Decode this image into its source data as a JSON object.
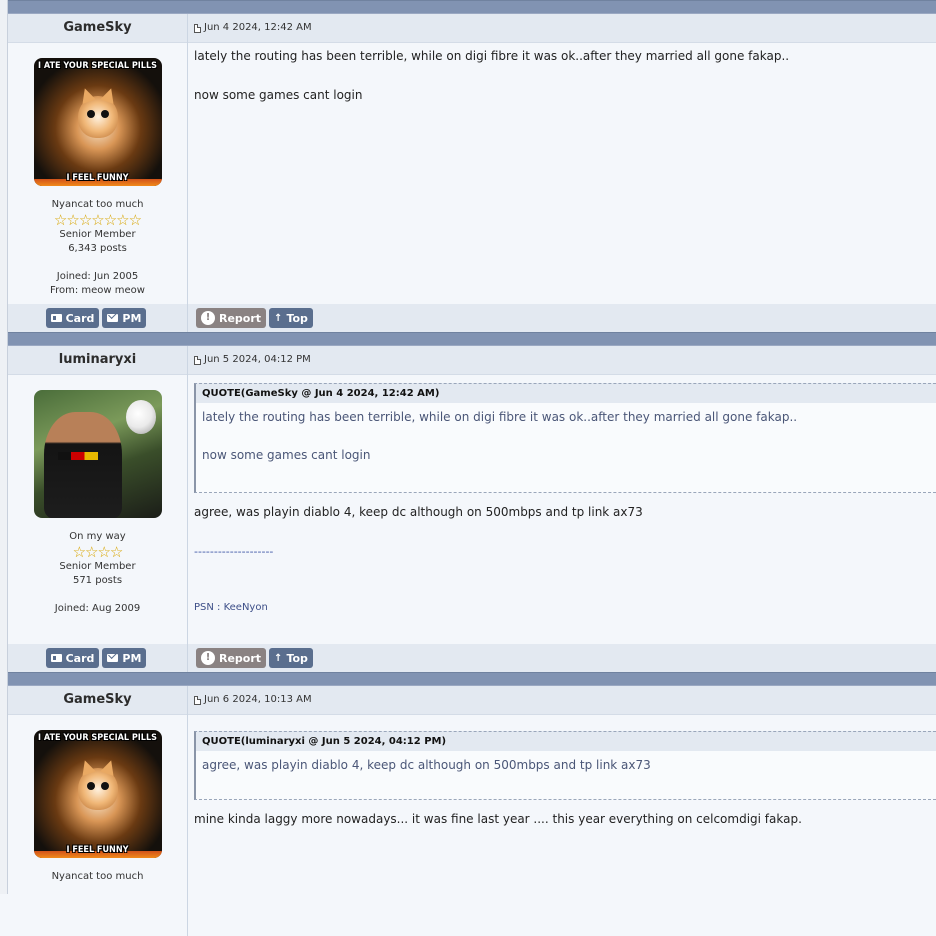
{
  "posts": [
    {
      "author": "GameSky",
      "date": "Jun 4 2024, 12:42 AM",
      "avatar": {
        "caption_top": "I ATE YOUR SPECIAL PILLS",
        "caption_bottom": "I FEEL FUNNY"
      },
      "title": "Nyancat too much",
      "stars": "☆☆☆☆☆☆☆",
      "rank": "Senior Member",
      "posts": "6,343 posts",
      "joined": "Joined: Jun 2005",
      "from": "From: meow meow",
      "body": [
        "lately the routing has been terrible, while on digi fibre it was ok..after they married all gone fakap..",
        "now some games cant login"
      ]
    },
    {
      "author": "luminaryxi",
      "date": "Jun 5 2024, 04:12 PM",
      "title": "On my way",
      "stars": "☆☆☆☆",
      "rank": "Senior Member",
      "posts": "571 posts",
      "joined": "Joined: Aug 2009",
      "quote": {
        "header": "QUOTE(GameSky @ Jun 4 2024, 12:42 AM)",
        "lines": [
          "lately the routing has been terrible, while on digi fibre it was ok..after they married all gone fakap..",
          "now some games cant login"
        ]
      },
      "body": [
        "agree, was playin diablo 4, keep dc although on 500mbps and tp link ax73"
      ],
      "sig_separator": "--------------------",
      "signature": "PSN : KeeNyon"
    },
    {
      "author": "GameSky",
      "date": "Jun 6 2024, 10:13 AM",
      "avatar": {
        "caption_top": "I ATE YOUR SPECIAL PILLS",
        "caption_bottom": "I FEEL FUNNY"
      },
      "title": "Nyancat too much",
      "quote": {
        "header": "QUOTE(luminaryxi @ Jun 5 2024, 04:12 PM)",
        "lines": [
          "agree, was playin diablo 4, keep dc although on 500mbps and tp link ax73"
        ]
      },
      "body": [
        "mine kinda laggy more nowadays... it was fine last year .... this year everything on celcomdigi fakap."
      ]
    }
  ],
  "buttons": {
    "card": "Card",
    "pm": "PM",
    "report": "Report",
    "top": "Top"
  },
  "icons": {
    "report": "!",
    "top": "↑"
  }
}
